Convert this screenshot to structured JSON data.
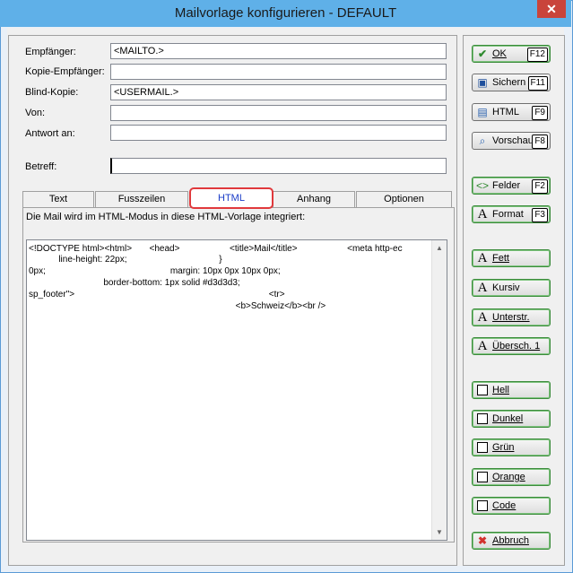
{
  "window": {
    "title": "Mailvorlage konfigurieren - DEFAULT",
    "close": "✕"
  },
  "form": {
    "empfaenger": {
      "label": "Empfänger:",
      "value": "<MAILTO.>"
    },
    "kopie": {
      "label": "Kopie-Empfänger:",
      "value": ""
    },
    "blind": {
      "label": "Blind-Kopie:",
      "value": "<USERMAIL.>"
    },
    "von": {
      "label": "Von:",
      "value": ""
    },
    "antwort": {
      "label": "Antwort an:",
      "value": ""
    },
    "betreff": {
      "label": "Betreff:",
      "value": ""
    }
  },
  "tabs": [
    "Text",
    "Fusszeilen",
    "HTML",
    "Anhang",
    "Optionen"
  ],
  "tab_info": "Die Mail wird im HTML-Modus in diese HTML-Vorlage integriert:",
  "code_lines": [
    "<!DOCTYPE html><html>       <head>                    <title>Mail</title>                    <meta http-ec",
    "            line-height: 22px;                                     }",
    "0px;                                                  margin: 10px 0px 10px 0px;",
    "                              border-bottom: 1px solid #d3d3d3;",
    "sp_footer\">                                                                              <tr>",
    "                                                                                   <b>Schweiz</b><br />"
  ],
  "buttons": {
    "ok": {
      "label": "OK",
      "key": "F12",
      "icon": "check-icon"
    },
    "sichern": {
      "label": "Sichern",
      "key": "F11",
      "icon": "save-icon"
    },
    "html": {
      "label": "HTML",
      "key": "F9",
      "icon": "page-icon"
    },
    "vorschau": {
      "label": "Vorschau",
      "key": "F8",
      "icon": "magnifier-icon"
    },
    "felder": {
      "label": "Felder",
      "key": "F2",
      "icon": "fields-icon"
    },
    "format": {
      "label": "Format",
      "key": "F3",
      "icon": "font-icon"
    },
    "fett": {
      "label": "Fett",
      "icon": "font-icon"
    },
    "kursiv": {
      "label": "Kursiv",
      "icon": "font-icon"
    },
    "unterstr": {
      "label": "Unterstr.",
      "icon": "font-icon"
    },
    "uebersch": {
      "label": "Übersch. 1",
      "icon": "font-icon"
    },
    "hell": {
      "label": "Hell",
      "icon": "checkbox-icon"
    },
    "dunkel": {
      "label": "Dunkel",
      "icon": "checkbox-icon"
    },
    "gruen": {
      "label": "Grün",
      "icon": "checkbox-icon"
    },
    "orange": {
      "label": "Orange",
      "icon": "checkbox-icon"
    },
    "code": {
      "label": "Code",
      "icon": "checkbox-icon"
    },
    "abbruch": {
      "label": "Abbruch",
      "icon": "x-icon"
    }
  },
  "colors": {
    "titlebar": "#5fb0e8",
    "close": "#c9443b",
    "active_tab_outline": "#e0393c",
    "accent_green": "#3c8c3c"
  }
}
